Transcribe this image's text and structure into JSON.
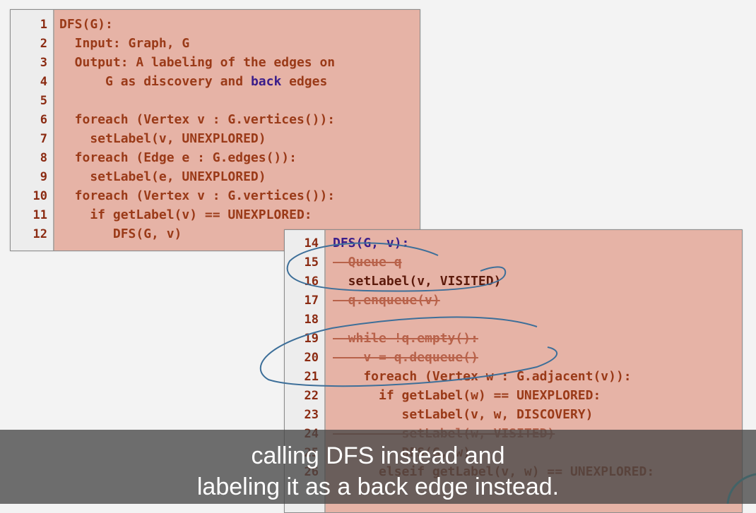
{
  "panel1": {
    "lines": [
      {
        "n": "1",
        "text": "DFS(G):"
      },
      {
        "n": "2",
        "text": "  Input: Graph, G"
      },
      {
        "n": "3",
        "text": "  Output: A labeling of the edges on"
      },
      {
        "n": "4",
        "text": "      G as discovery and ",
        "blue": "back",
        "after": " edges"
      },
      {
        "n": "5",
        "text": ""
      },
      {
        "n": "6",
        "text": "  foreach (Vertex v : G.vertices()):"
      },
      {
        "n": "7",
        "text": "    setLabel(v, UNEXPLORED)"
      },
      {
        "n": "8",
        "text": "  foreach (Edge e : G.edges()):"
      },
      {
        "n": "9",
        "text": "    setLabel(e, UNEXPLORED)"
      },
      {
        "n": "10",
        "text": "  foreach (Vertex v : G.vertices()):"
      },
      {
        "n": "11",
        "text": "    if getLabel(v) == UNEXPLORED:"
      },
      {
        "n": "12",
        "text": "       DFS(G, v)"
      }
    ]
  },
  "panel2": {
    "lines": [
      {
        "n": "14",
        "text": "DFS(G, v):",
        "style": "blue"
      },
      {
        "n": "15",
        "text": "  Queue q",
        "style": "struck"
      },
      {
        "n": "16",
        "text": "  setLabel(v, VISITED)",
        "style": "plain"
      },
      {
        "n": "17",
        "text": "  q.enqueue(v)",
        "style": "struck"
      },
      {
        "n": "18",
        "text": ""
      },
      {
        "n": "19",
        "text": "  while !q.empty():",
        "style": "struck"
      },
      {
        "n": "20",
        "text": "    v = q.dequeue()",
        "style": "struck"
      },
      {
        "n": "21",
        "text": "    foreach (Vertex w : G.adjacent(v)):"
      },
      {
        "n": "22",
        "text": "      if getLabel(w) == UNEXPLORED:"
      },
      {
        "n": "23",
        "text": "         setLabel(v, w, DISCOVERY)"
      },
      {
        "n": "24",
        "text": "         setLabel(w, VISITED)",
        "style": "struck"
      },
      {
        "n": "25",
        "text": "         DFS(G, w)"
      },
      {
        "n": "26",
        "text": "      elseif getLabel(v, w) == UNEXPLORED:"
      }
    ]
  },
  "subtitle": {
    "line1": "calling DFS instead and",
    "line2": "labeling it as a back edge instead."
  }
}
